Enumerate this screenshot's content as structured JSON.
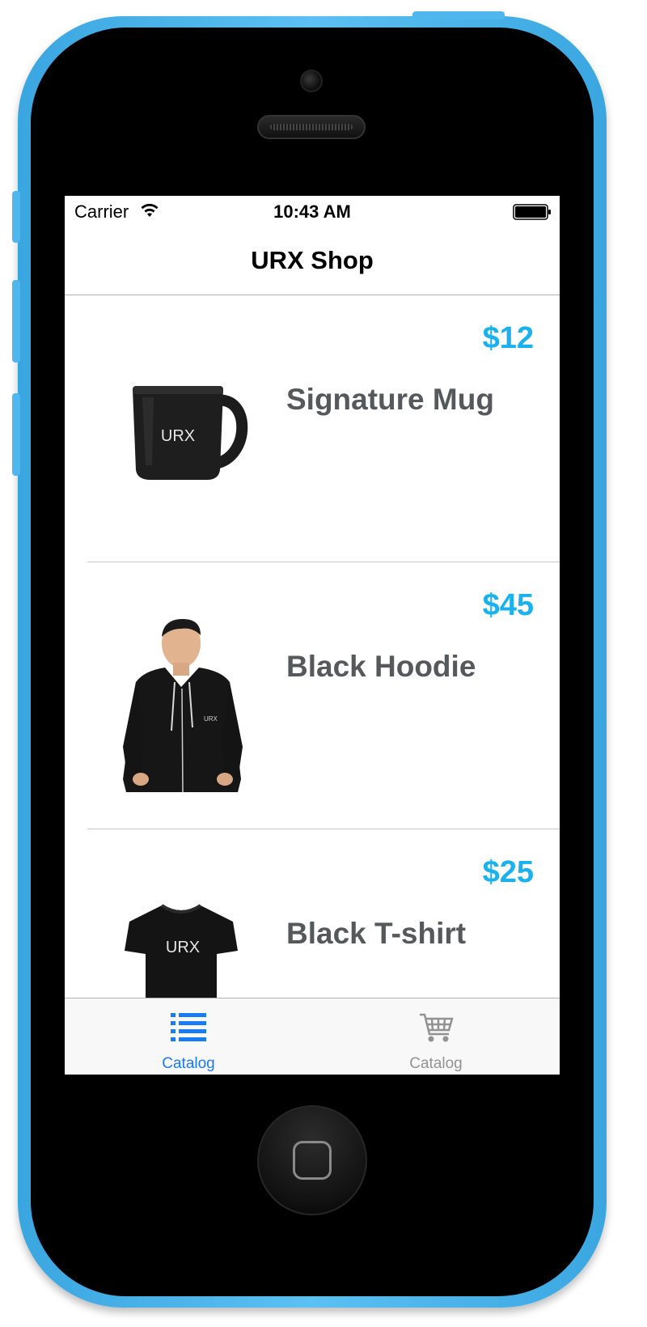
{
  "device": {
    "frame_color": "#4fb7ee"
  },
  "status_bar": {
    "carrier": "Carrier",
    "time": "10:43 AM",
    "wifi_icon": "wifi-icon",
    "battery_icon": "battery-icon"
  },
  "nav": {
    "title": "URX Shop"
  },
  "products": [
    {
      "name": "Signature Mug",
      "price": "$12",
      "image": "mug-image",
      "image_text": "URX"
    },
    {
      "name": "Black Hoodie",
      "price": "$45",
      "image": "hoodie-person-image",
      "image_text": "URX"
    },
    {
      "name": "Black T-shirt",
      "price": "$25",
      "image": "tshirt-image",
      "image_text": "URX"
    }
  ],
  "tab_bar": {
    "tabs": [
      {
        "label": "Catalog",
        "icon": "list-icon",
        "active": true,
        "color": "#1a7cf5"
      },
      {
        "label": "Catalog",
        "icon": "cart-icon",
        "active": false,
        "color": "#929292"
      }
    ]
  },
  "colors": {
    "price": "#1ab2ee",
    "product_name": "#56595b",
    "tab_active": "#1a7cf5",
    "tab_inactive": "#929292"
  }
}
